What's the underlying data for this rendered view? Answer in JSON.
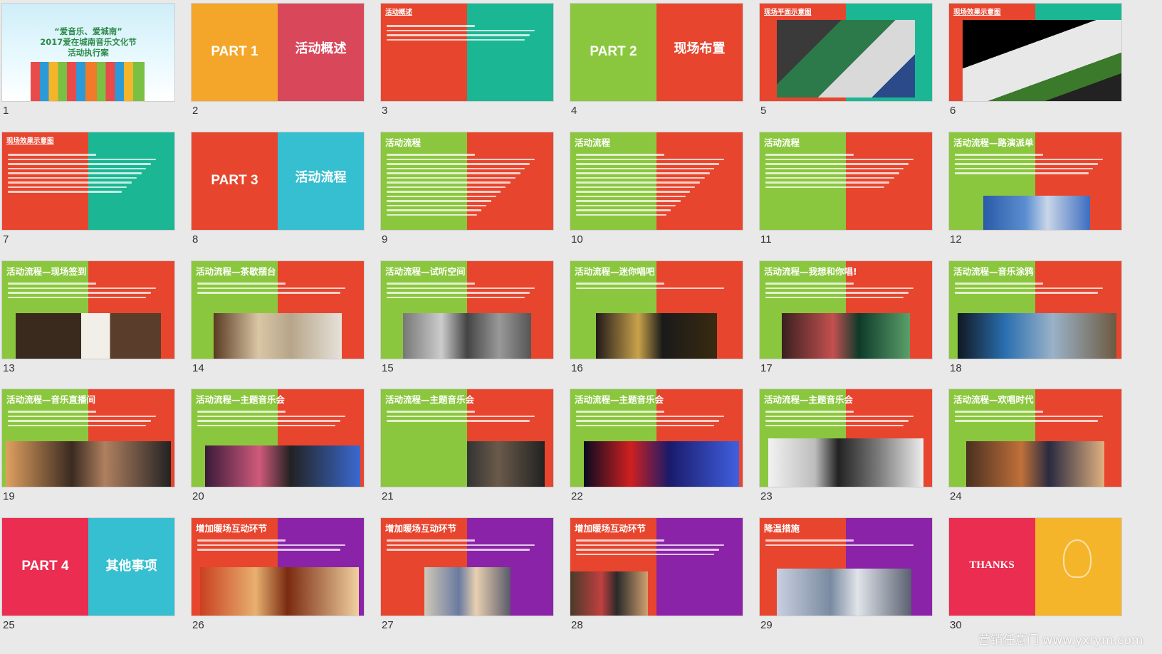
{
  "colors": {
    "orange": "#f4a62a",
    "rose": "#d8485a",
    "red": "#e8452e",
    "teal": "#1bb794",
    "green": "#8bc73e",
    "cyan": "#36bfd0",
    "pinkred": "#ea2d50",
    "purple": "#8a23a7",
    "yellow": "#f5b52b"
  },
  "cover": {
    "line1": "“爱音乐、爱城南”",
    "line2": "2017爱在城南音乐文化节",
    "line3": "活动执行案"
  },
  "slides": [
    {
      "num": "1",
      "kind": "cover",
      "title": ""
    },
    {
      "num": "2",
      "kind": "part",
      "part": "PART 1",
      "topic": "活动概述",
      "lc": "orange",
      "rc": "rose"
    },
    {
      "num": "3",
      "kind": "content",
      "title": "活动概述",
      "small": true,
      "lc": "red",
      "rc": "teal",
      "lines": 4,
      "img": ""
    },
    {
      "num": "4",
      "kind": "part",
      "part": "PART 2",
      "topic": "现场布置",
      "lc": "green",
      "rc": "red"
    },
    {
      "num": "5",
      "kind": "content",
      "title": "现场平面示意图",
      "small": true,
      "lc": "red",
      "rc": "teal",
      "lines": 0,
      "img": "plan"
    },
    {
      "num": "6",
      "kind": "content",
      "title": "现场效果示意图",
      "small": true,
      "lc": "red",
      "rc": "teal",
      "lines": 0,
      "img": "render"
    },
    {
      "num": "7",
      "kind": "content",
      "title": "现场效果示意图",
      "small": true,
      "lc": "red",
      "rc": "teal",
      "lines": 9,
      "img": ""
    },
    {
      "num": "8",
      "kind": "part",
      "part": "PART 3",
      "topic": "活动流程",
      "lc": "red",
      "rc": "cyan"
    },
    {
      "num": "9",
      "kind": "content",
      "title": "活动流程",
      "lc": "green",
      "rc": "red",
      "lines": 14,
      "img": ""
    },
    {
      "num": "10",
      "kind": "content",
      "title": "活动流程",
      "lc": "green",
      "rc": "red",
      "lines": 14,
      "img": ""
    },
    {
      "num": "11",
      "kind": "content",
      "title": "活动流程",
      "lc": "green",
      "rc": "red",
      "lines": 8,
      "img": ""
    },
    {
      "num": "12",
      "kind": "content",
      "title": "活动流程—路演派单",
      "lc": "green",
      "rc": "red",
      "lines": 5,
      "img": "crowd"
    },
    {
      "num": "13",
      "kind": "content",
      "title": "活动流程—现场签到",
      "lc": "green",
      "rc": "red",
      "lines": 4,
      "img": "signin"
    },
    {
      "num": "14",
      "kind": "content",
      "title": "活动流程—茶歇摆台",
      "lc": "green",
      "rc": "red",
      "lines": 3,
      "img": "buffet"
    },
    {
      "num": "15",
      "kind": "content",
      "title": "活动流程—试听空间",
      "lc": "green",
      "rc": "red",
      "lines": 4,
      "img": "booth"
    },
    {
      "num": "16",
      "kind": "content",
      "title": "活动流程—迷你唱吧",
      "lc": "green",
      "rc": "red",
      "lines": 2,
      "img": "ktv"
    },
    {
      "num": "17",
      "kind": "content",
      "title": "活动流程—我想和你唱!",
      "lc": "green",
      "rc": "red",
      "lines": 4,
      "img": "sing"
    },
    {
      "num": "18",
      "kind": "content",
      "title": "活动流程—音乐涂鸦",
      "lc": "green",
      "rc": "red",
      "lines": 3,
      "img": "tablet"
    },
    {
      "num": "19",
      "kind": "content",
      "title": "活动流程—音乐直播间",
      "lc": "green",
      "rc": "red",
      "lines": 4,
      "img": "live"
    },
    {
      "num": "20",
      "kind": "content",
      "title": "活动流程—主题音乐会",
      "lc": "green",
      "rc": "red",
      "lines": 4,
      "img": "stage"
    },
    {
      "num": "21",
      "kind": "content",
      "title": "活动流程—主题音乐会",
      "lc": "green",
      "rc": "red",
      "lines": 3,
      "img": "singer"
    },
    {
      "num": "22",
      "kind": "content",
      "title": "活动流程—主题音乐会",
      "lc": "green",
      "rc": "red",
      "lines": 4,
      "img": "mlive"
    },
    {
      "num": "23",
      "kind": "content",
      "title": "活动流程—主题音乐会",
      "lc": "green",
      "rc": "red",
      "lines": 4,
      "img": "vr"
    },
    {
      "num": "24",
      "kind": "content",
      "title": "活动流程—欢唱时代",
      "lc": "green",
      "rc": "red",
      "lines": 3,
      "img": "party"
    },
    {
      "num": "25",
      "kind": "part",
      "part": "PART 4",
      "topic": "其他事项",
      "lc": "pinkred",
      "rc": "cyan"
    },
    {
      "num": "26",
      "kind": "content",
      "title": "增加暖场互动环节",
      "lc": "red",
      "rc": "purple",
      "lines": 3,
      "img": "food"
    },
    {
      "num": "27",
      "kind": "content",
      "title": "增加暖场互动环节",
      "lc": "red",
      "rc": "purple",
      "lines": 3,
      "img": "kids"
    },
    {
      "num": "28",
      "kind": "content",
      "title": "增加暖场互动环节",
      "lc": "red",
      "rc": "purple",
      "lines": 4,
      "img": "arcade"
    },
    {
      "num": "29",
      "kind": "content",
      "title": "降温措施",
      "lc": "red",
      "rc": "purple",
      "lines": 2,
      "img": "tent"
    },
    {
      "num": "30",
      "kind": "thanks",
      "title": "THANKS",
      "lc": "pinkred",
      "rc": "yellow"
    }
  ],
  "watermark": "营销任意门 www.yxrym.com"
}
